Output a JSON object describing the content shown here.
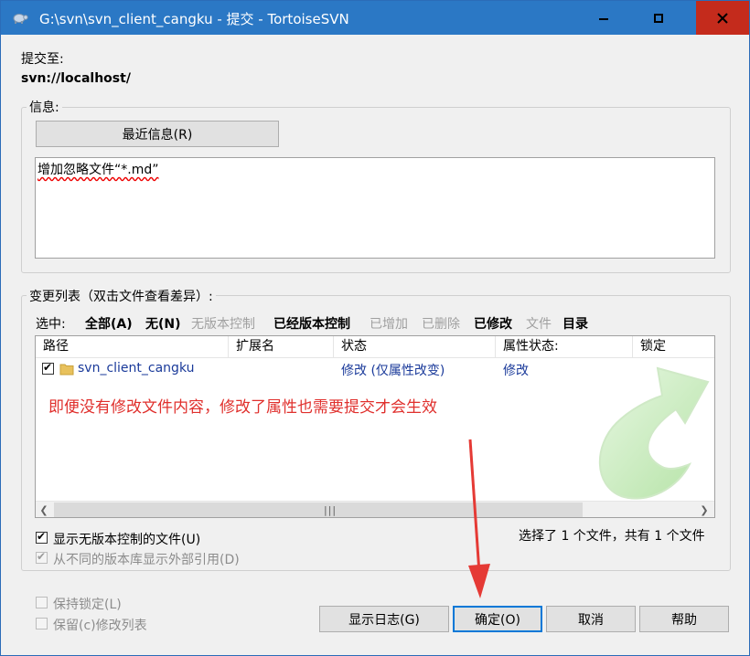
{
  "window": {
    "title": "G:\\svn\\svn_client_cangku - 提交 - TortoiseSVN",
    "colors": {
      "titlebar": "#2b78c5",
      "close": "#c42b1c",
      "annotation": "#e0302d"
    }
  },
  "commit_to": {
    "label": "提交至:",
    "url": "svn://localhost/"
  },
  "message": {
    "group_label": "信息:",
    "recent_button": "最近信息(R)",
    "text": "增加忽略文件“*.md”"
  },
  "changes": {
    "group_label": "变更列表（双击文件查看差异）:",
    "select_label": "选中:",
    "filters": [
      {
        "label": "全部(A)",
        "enabled": true
      },
      {
        "label": "无(N)",
        "enabled": true
      },
      {
        "label": "无版本控制",
        "enabled": false
      },
      {
        "label": "已经版本控制",
        "enabled": true
      },
      {
        "label": "已增加",
        "enabled": false
      },
      {
        "label": "已删除",
        "enabled": false
      },
      {
        "label": "已修改",
        "enabled": true
      },
      {
        "label": "文件",
        "enabled": false
      },
      {
        "label": "目录",
        "enabled": true
      }
    ],
    "columns": [
      "路径",
      "扩展名",
      "状态",
      "属性状态:",
      "锁定"
    ],
    "rows": [
      {
        "checked": true,
        "path": "svn_client_cangku",
        "ext": "",
        "status": "修改 (仅属性改变)",
        "prop_status": "修改",
        "lock": ""
      }
    ],
    "annotation": "即便没有修改文件内容，修改了属性也需要提交才会生效",
    "summary": "选择了 1 个文件，共有 1 个文件"
  },
  "options": {
    "show_unversioned": {
      "label": "显示无版本控制的文件(U)",
      "checked": true
    },
    "show_externals": {
      "label": "从不同的版本库显示外部引用(D)",
      "checked": true,
      "disabled": true
    },
    "keep_locks": {
      "label": "保持锁定(L)",
      "checked": false,
      "disabled": true
    },
    "keep_changelists": {
      "label": "保留(c)修改列表",
      "checked": false,
      "disabled": true
    }
  },
  "buttons": {
    "show_log": "显示日志(G)",
    "ok": "确定(O)",
    "cancel": "取消",
    "help": "帮助"
  }
}
